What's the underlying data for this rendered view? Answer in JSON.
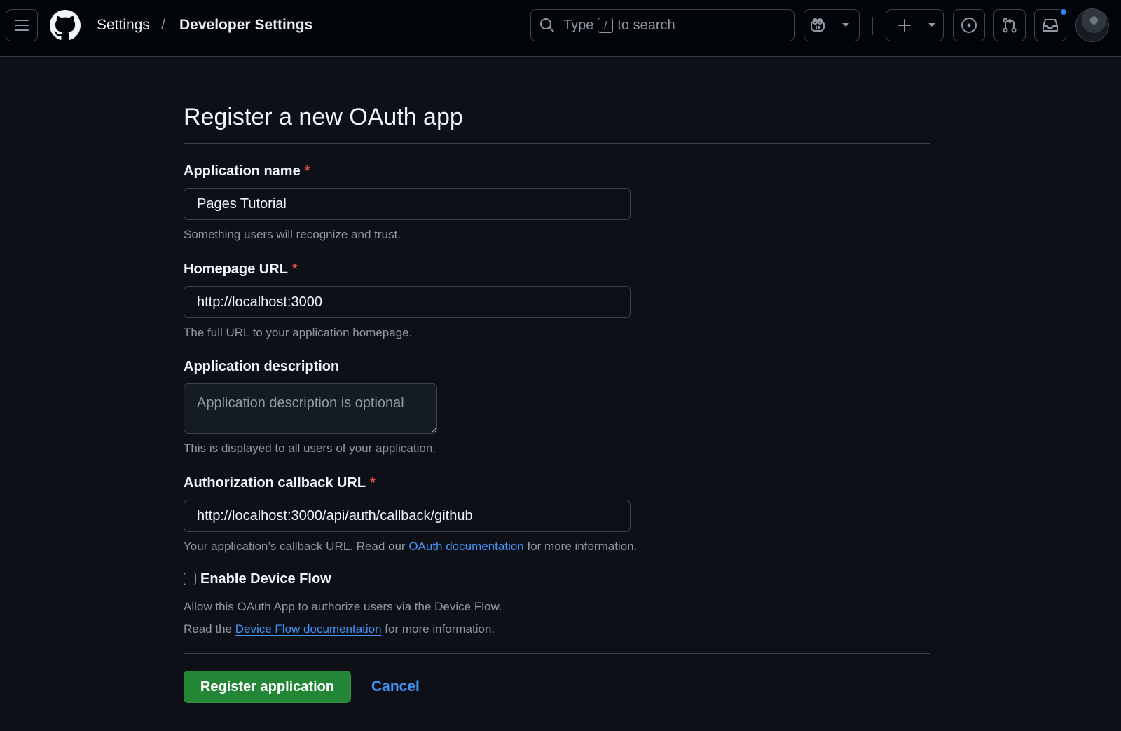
{
  "header": {
    "breadcrumb": [
      "Settings",
      "/",
      "Developer Settings"
    ],
    "search": {
      "prefix": "Type",
      "key": "/",
      "suffix": "to search"
    }
  },
  "page": {
    "title": "Register a new OAuth app"
  },
  "form": {
    "app_name": {
      "label": "Application name",
      "required_mark": "*",
      "value": "Pages Tutorial",
      "hint": "Something users will recognize and trust."
    },
    "homepage_url": {
      "label": "Homepage URL",
      "required_mark": "*",
      "value": "http://localhost:3000",
      "hint": "The full URL to your application homepage."
    },
    "description": {
      "label": "Application description",
      "placeholder": "Application description is optional",
      "hint": "This is displayed to all users of your application."
    },
    "callback_url": {
      "label": "Authorization callback URL",
      "required_mark": "*",
      "value": "http://localhost:3000/api/auth/callback/github",
      "hint_before": "Your application’s callback URL. Read our",
      "hint_link": "OAuth documentation",
      "hint_after": "for more information."
    },
    "device_flow": {
      "label": "Enable Device Flow",
      "checked": false,
      "hint_line1": "Allow this OAuth App to authorize users via the Device Flow.",
      "hint_line2_before": "Read the",
      "hint_line2_link": "Device Flow documentation",
      "hint_line2_after": "for more information."
    }
  },
  "actions": {
    "submit_label": "Register application",
    "cancel_label": "Cancel"
  },
  "colors": {
    "background": "#0d1117",
    "header": "#010409",
    "primary_button": "#238636",
    "link": "#4493f8",
    "required": "#f85149",
    "notification_dot": "#2f81f7"
  },
  "icons": [
    "hamburger-icon",
    "github-logo",
    "search-icon",
    "copilot-icon",
    "chevron-down-icon",
    "plus-icon",
    "issue-icon",
    "pull-request-icon",
    "inbox-icon"
  ]
}
